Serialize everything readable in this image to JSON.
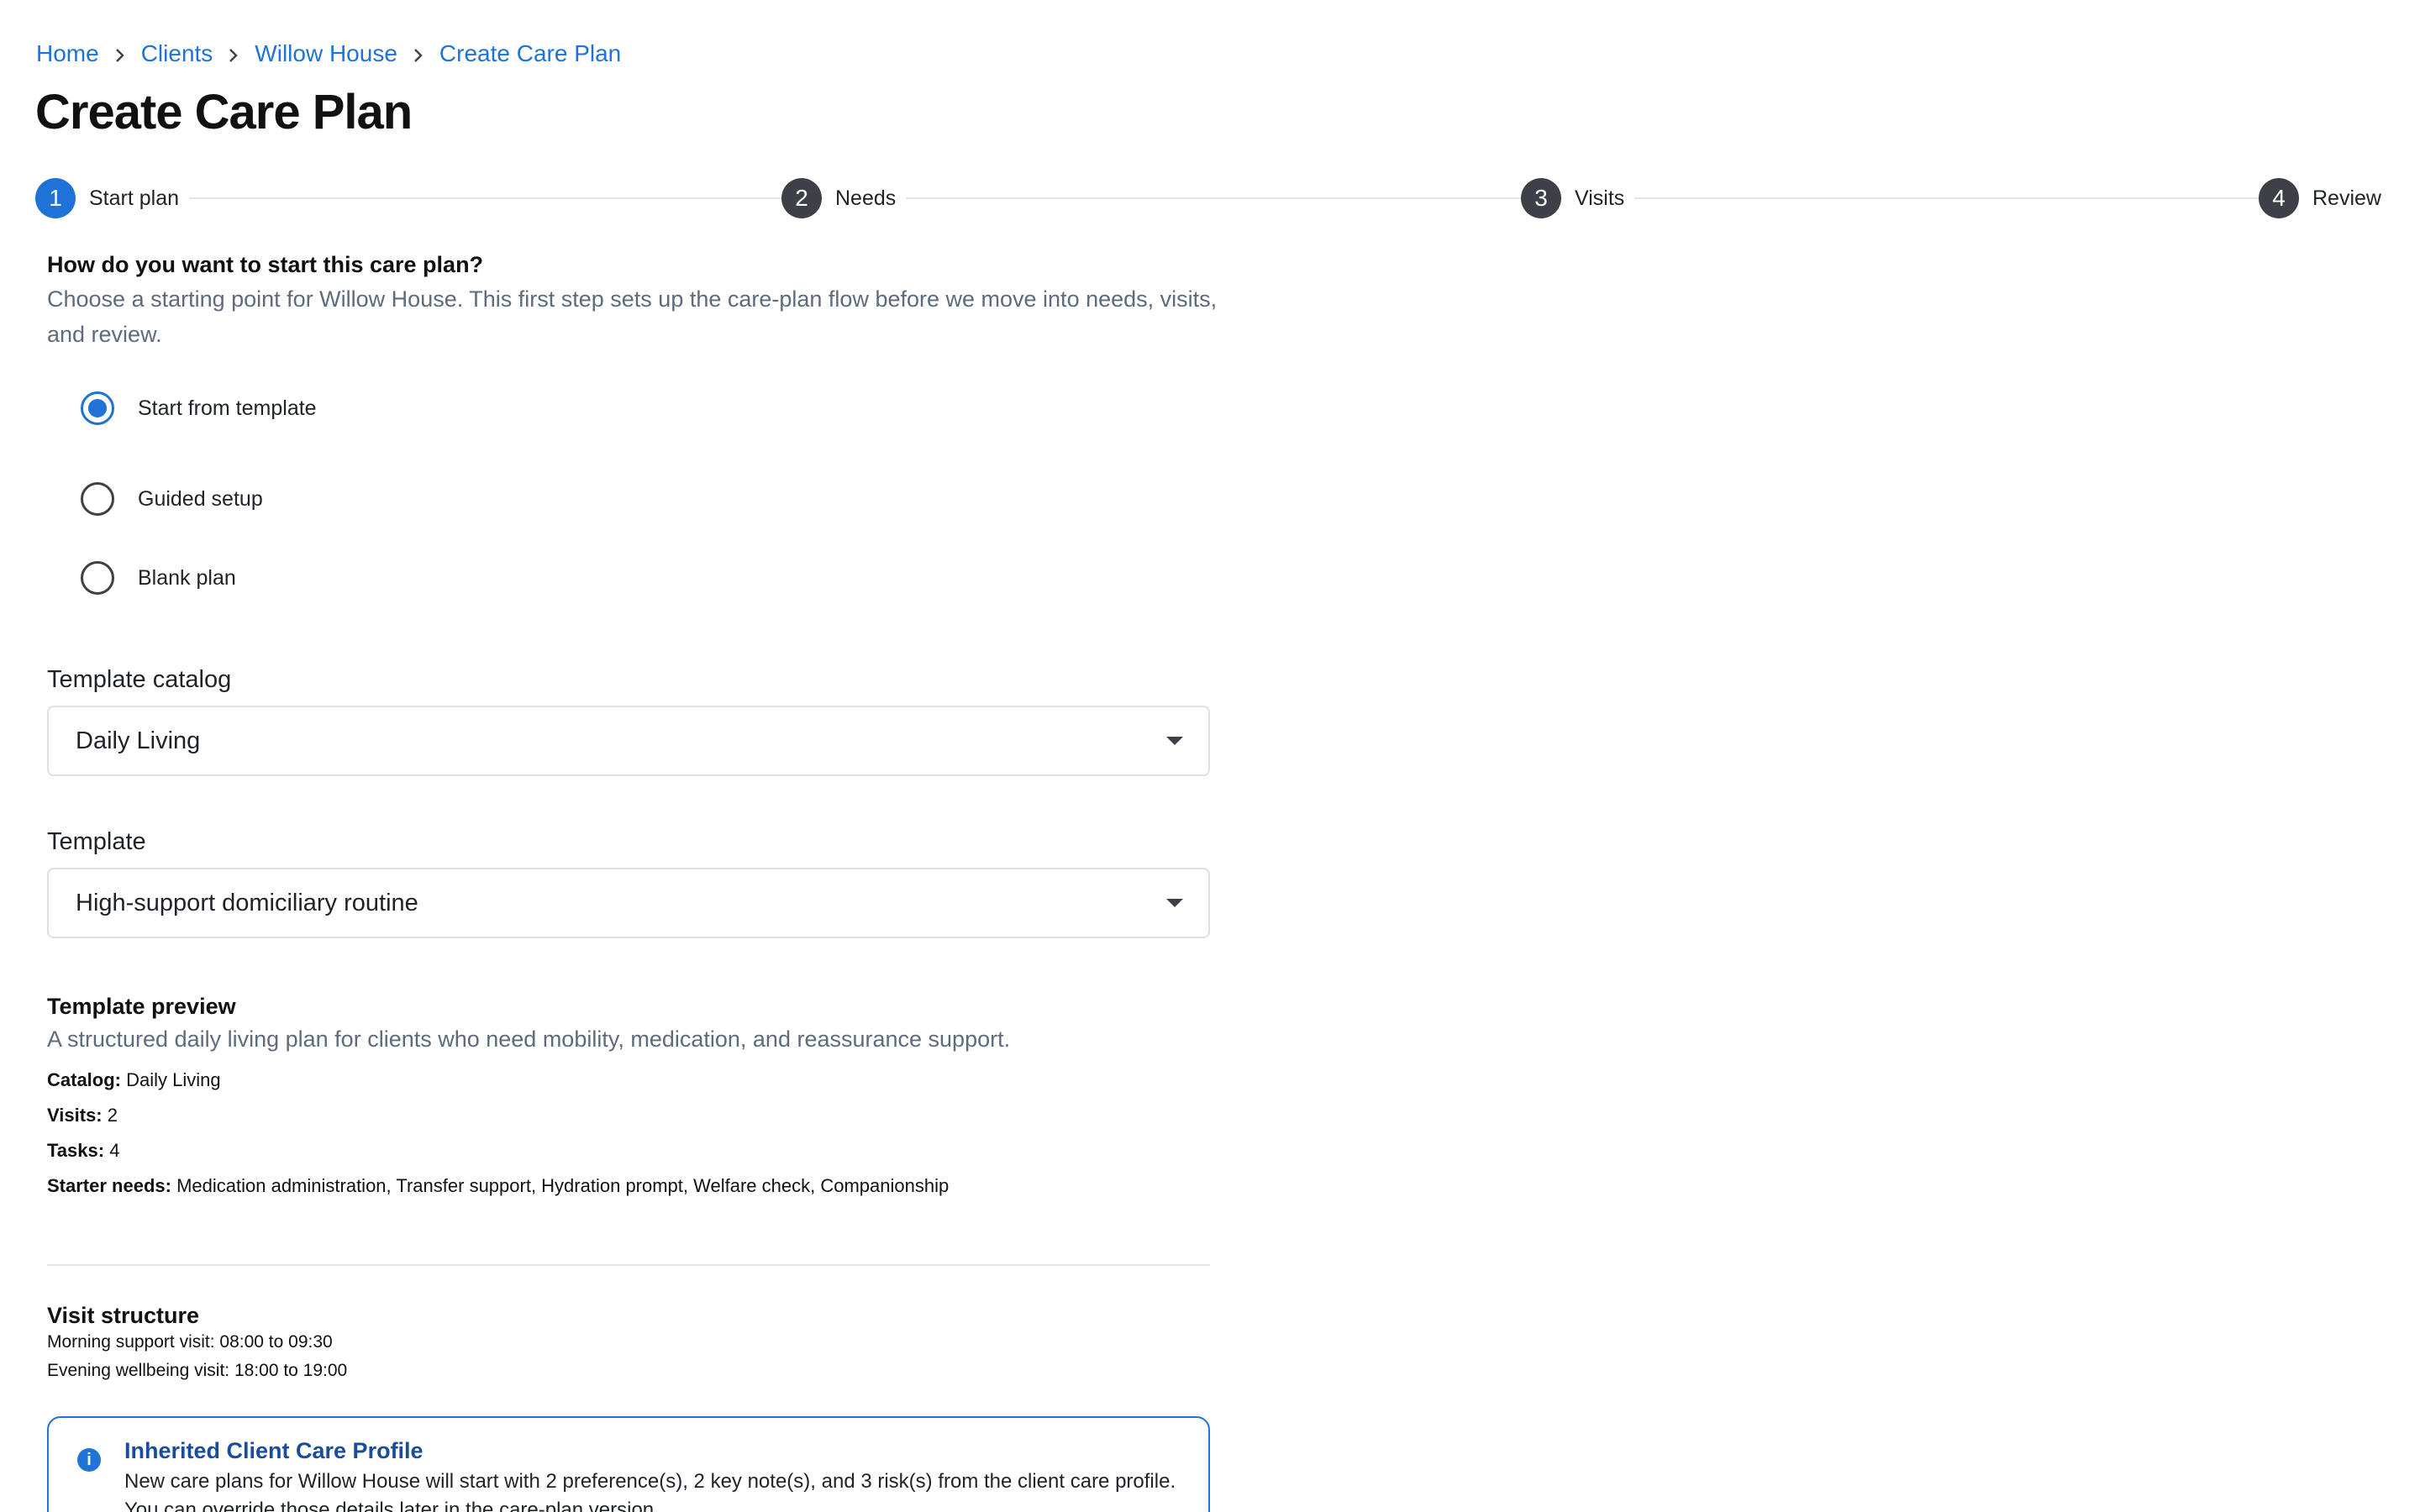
{
  "breadcrumb": {
    "items": [
      "Home",
      "Clients",
      "Willow House",
      "Create Care Plan"
    ]
  },
  "page_title": "Create Care Plan",
  "stepper": {
    "steps": [
      {
        "number": "1",
        "label": "Start plan",
        "active": true
      },
      {
        "number": "2",
        "label": "Needs",
        "active": false
      },
      {
        "number": "3",
        "label": "Visits",
        "active": false
      },
      {
        "number": "4",
        "label": "Review",
        "active": false
      }
    ]
  },
  "start": {
    "question": "How do you want to start this care plan?",
    "helper": "Choose a starting point for Willow House. This first step sets up the care-plan flow before we move into needs, visits, and review.",
    "options": [
      {
        "label": "Start from template",
        "checked": true
      },
      {
        "label": "Guided setup",
        "checked": false
      },
      {
        "label": "Blank plan",
        "checked": false
      }
    ]
  },
  "template_catalog": {
    "label": "Template catalog",
    "value": "Daily Living"
  },
  "template": {
    "label": "Template",
    "value": "High-support domiciliary routine"
  },
  "preview": {
    "title": "Template preview",
    "description": "A structured daily living plan for clients who need mobility, medication, and reassurance support.",
    "catalog_key": "Catalog:",
    "catalog_value": "Daily Living",
    "visits_key": "Visits:",
    "visits_value": "2",
    "tasks_key": "Tasks:",
    "tasks_value": "4",
    "needs_key": "Starter needs:",
    "needs_value": "Medication administration, Transfer support, Hydration prompt, Welfare check, Companionship"
  },
  "visit_structure": {
    "title": "Visit structure",
    "rows": [
      "Morning support visit: 08:00 to 09:30",
      "Evening wellbeing visit: 18:00 to 19:00"
    ]
  },
  "inherited": {
    "title": "Inherited Client Care Profile",
    "text": "New care plans for Willow House will start with 2 preference(s), 2 key note(s), and 3 risk(s) from the client care profile. You can override those details later in the care-plan version."
  },
  "colors": {
    "accent": "#1f73d6",
    "step_inactive": "#3d4147",
    "muted_text": "#5d6b7d"
  }
}
